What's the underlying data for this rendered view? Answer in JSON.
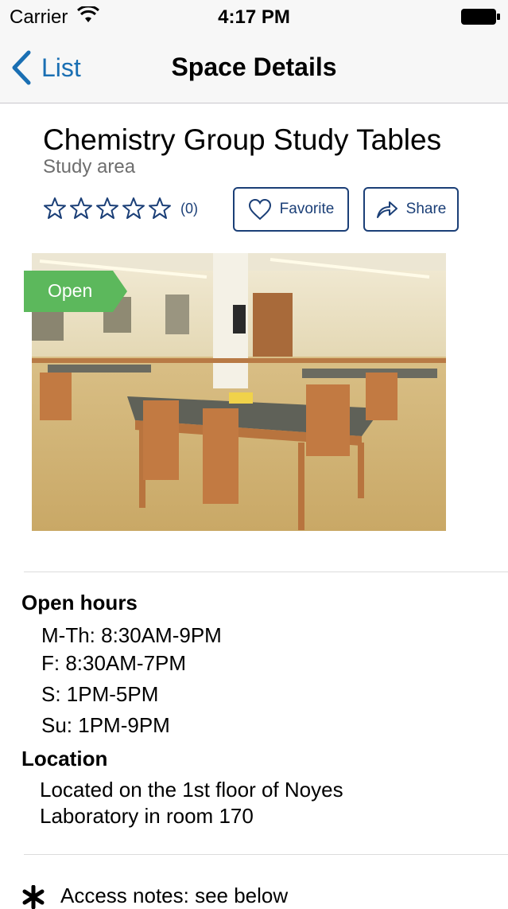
{
  "status_bar": {
    "carrier": "Carrier",
    "time": "4:17 PM"
  },
  "nav": {
    "back_label": "List",
    "title": "Space Details"
  },
  "space": {
    "title": "Chemistry Group Study Tables",
    "type": "Study area",
    "rating_stars": 0,
    "rating_max": 5,
    "rating_count": "(0)",
    "open_badge": "Open"
  },
  "actions": {
    "favorite_label": "Favorite",
    "share_label": "Share"
  },
  "hours": {
    "heading": "Open hours",
    "lines": [
      "M-Th: 8:30AM-9PM",
      "F: 8:30AM-7PM",
      "S: 1PM-5PM",
      "Su: 1PM-9PM"
    ]
  },
  "location": {
    "heading": "Location",
    "lines": [
      "Located on the 1st floor of Noyes",
      "Laboratory in room 170"
    ]
  },
  "access": {
    "text": "Access notes: see below"
  },
  "colors": {
    "nav_blue": "#1a6fb3",
    "button_navy": "#1b3f77",
    "open_green": "#5cb85c"
  },
  "icons": [
    "wifi-icon",
    "battery-icon",
    "back-chevron-icon",
    "star-icon",
    "heart-icon",
    "share-arrow-icon",
    "asterisk-icon"
  ]
}
